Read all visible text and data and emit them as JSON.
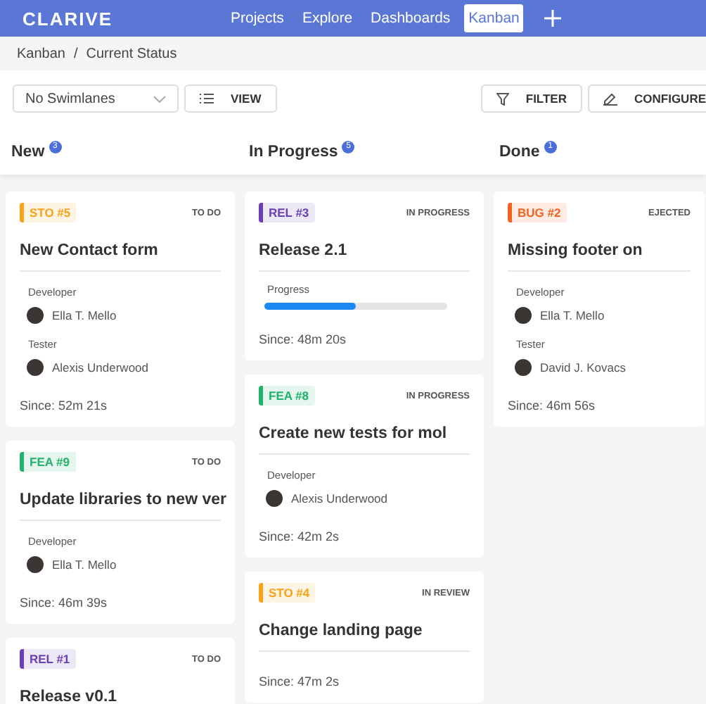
{
  "nav": {
    "brand": "CLARIVE",
    "items": [
      {
        "label": "Projects",
        "selected": false
      },
      {
        "label": "Explore",
        "selected": false
      },
      {
        "label": "Dashboards",
        "selected": false
      },
      {
        "label": "Kanban",
        "selected": true
      }
    ]
  },
  "breadcrumb": {
    "items": [
      "Kanban",
      "Current Status"
    ],
    "separator": "/"
  },
  "toolbar": {
    "swimlanes": "No Swimlanes",
    "view": "VIEW",
    "filter": "FILTER",
    "configure": "CONFIGURE"
  },
  "columns": [
    {
      "title": "New",
      "count": "3",
      "cards": [
        {
          "tag": "STO #5",
          "color": "#f7a21b",
          "status": "TO DO",
          "title": "New Contact form",
          "roles": [
            {
              "role": "Developer",
              "name": "Ella T. Mello"
            },
            {
              "role": "Tester",
              "name": "Alexis Underwood"
            }
          ],
          "since": "Since: 52m 21s"
        },
        {
          "tag": "FEA #9",
          "color": "#21b36b",
          "status": "TO DO",
          "title": "Update libraries to new ver",
          "roles": [
            {
              "role": "Developer",
              "name": "Ella T. Mello"
            }
          ],
          "since": "Since: 46m 39s"
        },
        {
          "tag": "REL #1",
          "color": "#6a3fb5",
          "status": "TO DO",
          "title": "Release v0.1"
        }
      ]
    },
    {
      "title": "In Progress",
      "count": "5",
      "cards": [
        {
          "tag": "REL #3",
          "color": "#6a3fb5",
          "status": "IN PROGRESS",
          "title": "Release 2.1",
          "progress": {
            "label": "Progress",
            "level": 0.5
          },
          "since": "Since: 48m 20s"
        },
        {
          "tag": "FEA #8",
          "color": "#21b36b",
          "status": "IN PROGRESS",
          "title": "Create new tests for mol",
          "roles": [
            {
              "role": "Developer",
              "name": "Alexis Underwood"
            }
          ],
          "since": "Since: 42m 2s"
        },
        {
          "tag": "STO #4",
          "color": "#f7a21b",
          "status": "IN REVIEW",
          "title": "Change landing page",
          "since": "Since: 47m 2s"
        }
      ]
    },
    {
      "title": "Done",
      "count": "1",
      "cards": [
        {
          "tag": "BUG #2",
          "color": "#f4621f",
          "status": "EJECTED",
          "title": "Missing footer on",
          "roles": [
            {
              "role": "Developer",
              "name": "Ella T. Mello"
            },
            {
              "role": "Tester",
              "name": "David J. Kovacs"
            }
          ],
          "since": "Since: 46m 56s"
        }
      ]
    }
  ]
}
